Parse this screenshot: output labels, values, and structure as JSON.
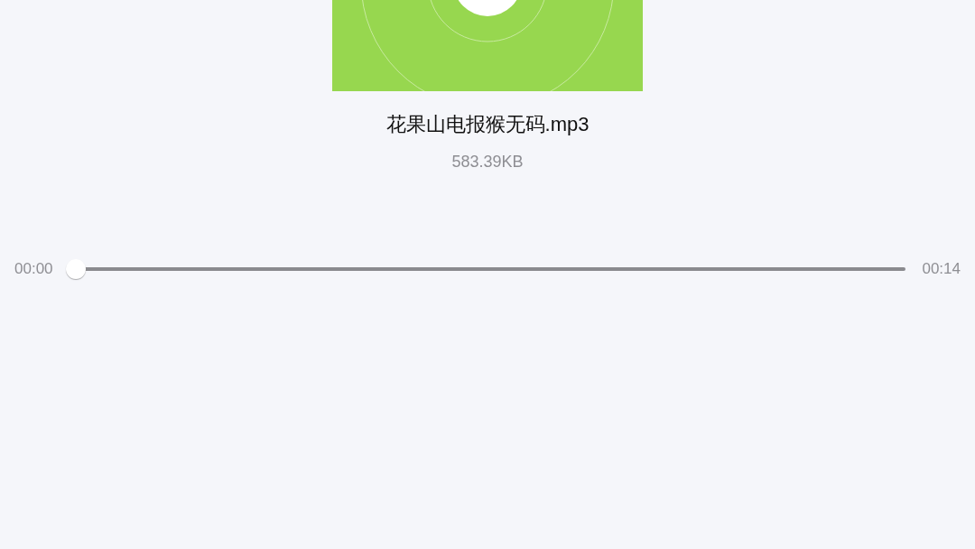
{
  "file": {
    "name": "花果山电报猴无码.mp3",
    "size": "583.39KB"
  },
  "player": {
    "elapsed": "00:00",
    "duration": "00:14",
    "level": 0
  }
}
